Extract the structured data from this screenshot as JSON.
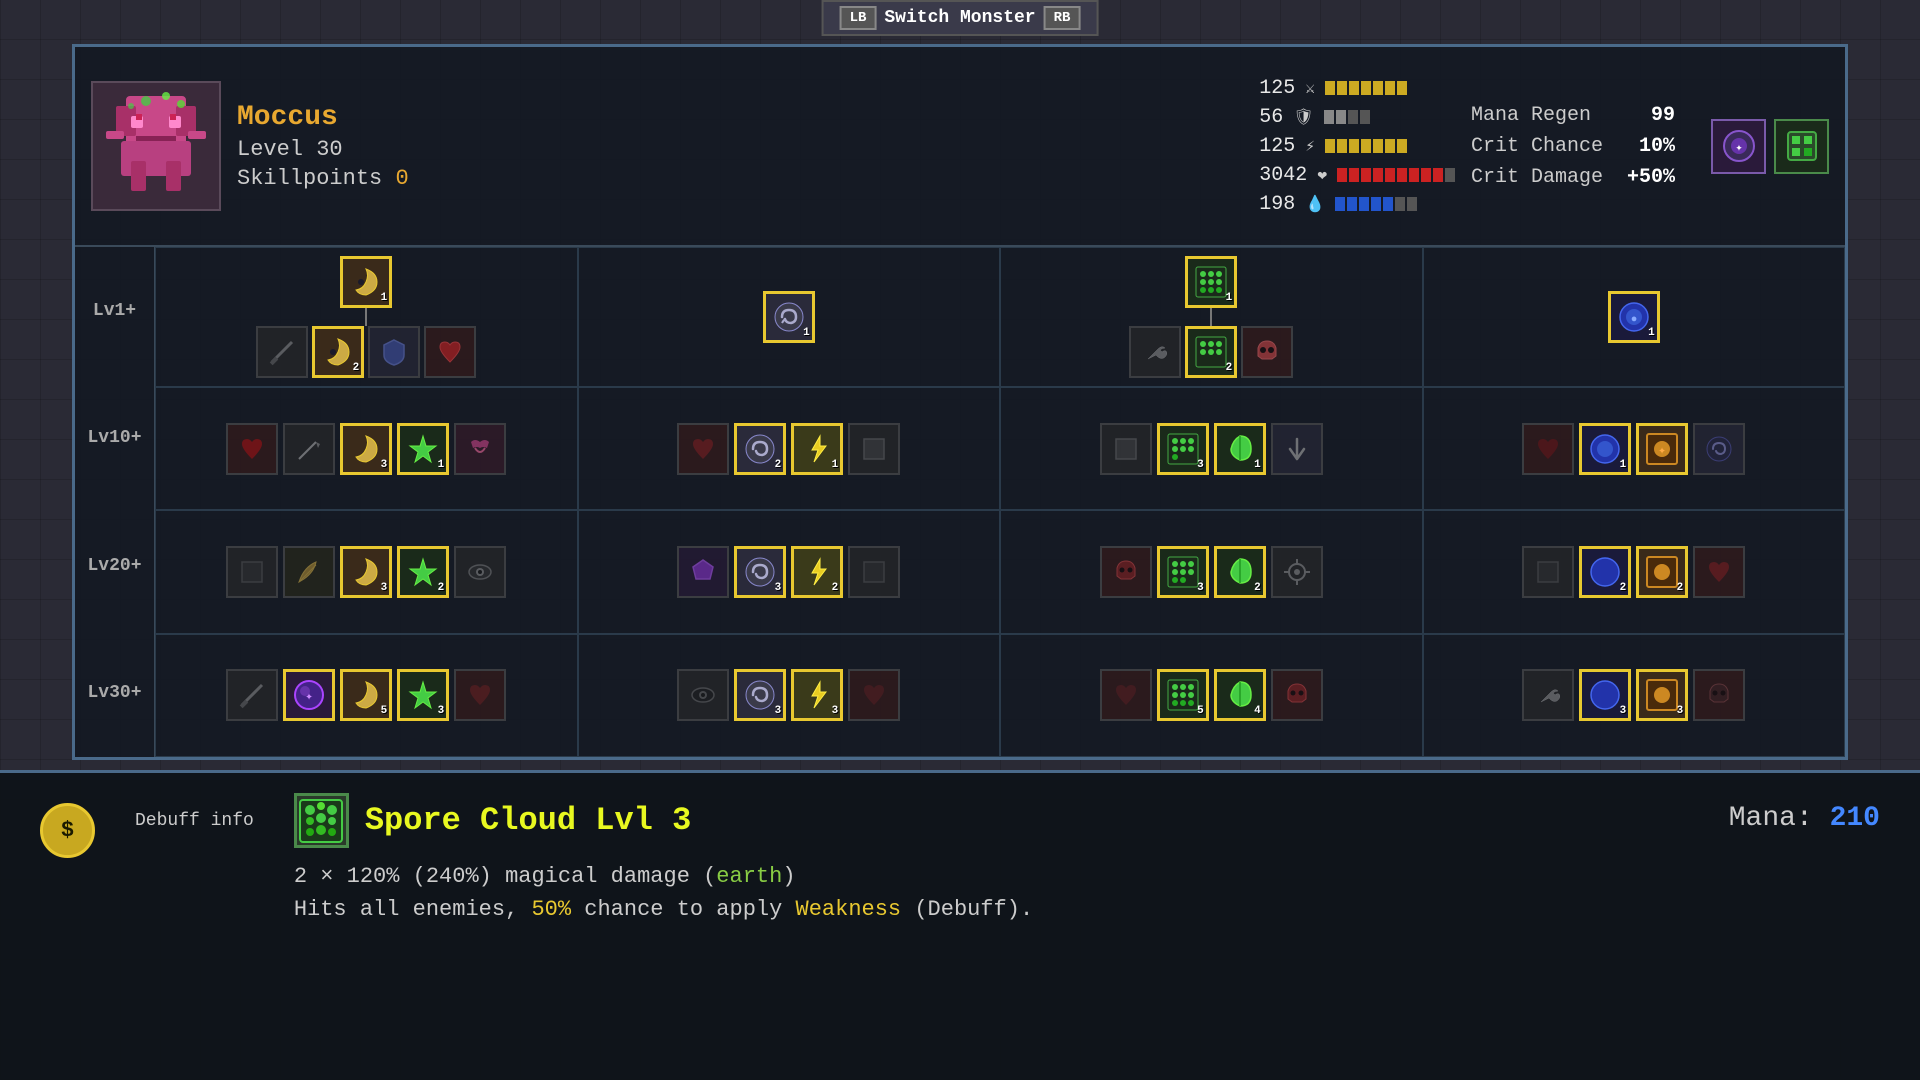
{
  "topBar": {
    "leftTag": "LB",
    "label": "Switch Monster",
    "rightTag": "RB"
  },
  "monster": {
    "name": "Moccus",
    "level": "Level 30",
    "skillpoints_label": "Skillpoints",
    "skillpoints_val": "0",
    "stats": {
      "atk": {
        "val": "125",
        "bars": 7,
        "filled": 7
      },
      "def": {
        "val": "56",
        "bars": 2,
        "filled": 2
      },
      "spd": {
        "val": "125",
        "bars": 7,
        "filled": 7
      },
      "hp": {
        "val": "3042",
        "bars": 9,
        "filled": 9
      },
      "mana": {
        "val": "198",
        "bars": 7,
        "filled": 5
      }
    },
    "rightStats": {
      "mana_regen_label": "Mana Regen",
      "mana_regen_val": "99",
      "crit_chance_label": "Crit Chance",
      "crit_chance_val": "10%",
      "crit_damage_label": "Crit Damage",
      "crit_damage_val": "+50%"
    }
  },
  "levelLabels": [
    "Lv1+",
    "Lv10+",
    "Lv20+",
    "Lv30+"
  ],
  "skillTree": {
    "cols": 4,
    "rows": 4,
    "sections": [
      {
        "row": 0,
        "col": 0,
        "skills": [
          {
            "icon": "🌙",
            "border": "yellow",
            "level": "1",
            "main": true
          },
          {
            "icon": "⚔",
            "border": "gray",
            "level": "",
            "main": false
          },
          {
            "icon": "🌙",
            "border": "yellow",
            "level": "2",
            "main": true
          },
          {
            "icon": "🛡",
            "border": "gray",
            "level": "",
            "main": false
          },
          {
            "icon": "❤",
            "border": "gray",
            "level": "",
            "main": false
          }
        ]
      },
      {
        "row": 0,
        "col": 1,
        "skills": [
          {
            "icon": "🌀",
            "border": "yellow",
            "level": "1",
            "main": true
          }
        ]
      },
      {
        "row": 0,
        "col": 2,
        "skills": [
          {
            "icon": "⬛",
            "border": "yellow",
            "level": "1",
            "main": true
          },
          {
            "icon": "🔧",
            "border": "gray",
            "level": "",
            "main": false
          },
          {
            "icon": "⬛",
            "border": "yellow",
            "level": "2",
            "main": true
          },
          {
            "icon": "💀",
            "border": "gray",
            "level": "",
            "main": false
          }
        ]
      },
      {
        "row": 0,
        "col": 3,
        "skills": [
          {
            "icon": "💧",
            "border": "yellow",
            "level": "1",
            "main": true
          }
        ]
      },
      {
        "row": 1,
        "col": 0,
        "skills": [
          {
            "icon": "❤",
            "border": "gray",
            "level": "",
            "main": false
          },
          {
            "icon": "🔪",
            "border": "gray",
            "level": "",
            "main": false
          },
          {
            "icon": "🌙",
            "border": "yellow",
            "level": "3",
            "main": true
          },
          {
            "icon": "✳",
            "border": "yellow",
            "level": "1",
            "main": true
          },
          {
            "icon": "😈",
            "border": "gray",
            "level": "",
            "main": false
          }
        ]
      },
      {
        "row": 1,
        "col": 1,
        "skills": [
          {
            "icon": "❤",
            "border": "gray",
            "level": "",
            "main": false
          },
          {
            "icon": "🌀",
            "border": "yellow",
            "level": "2",
            "main": true
          },
          {
            "icon": "⚡",
            "border": "yellow",
            "level": "1",
            "main": true
          },
          {
            "icon": "⬛",
            "border": "gray",
            "level": "",
            "main": false
          }
        ]
      },
      {
        "row": 1,
        "col": 2,
        "skills": [
          {
            "icon": "⬛",
            "border": "gray",
            "level": "",
            "main": false
          },
          {
            "icon": "⬛",
            "border": "yellow",
            "level": "3",
            "main": true
          },
          {
            "icon": "🌿",
            "border": "yellow",
            "level": "1",
            "main": true
          },
          {
            "icon": "⬇",
            "border": "gray",
            "level": "",
            "main": false
          }
        ]
      },
      {
        "row": 1,
        "col": 3,
        "skills": [
          {
            "icon": "❤",
            "border": "gray",
            "level": "",
            "main": false
          },
          {
            "icon": "💧",
            "border": "yellow",
            "level": "1",
            "main": true
          },
          {
            "icon": "🟡",
            "border": "yellow",
            "level": "",
            "main": false
          },
          {
            "icon": "🌀",
            "border": "gray",
            "level": "",
            "main": false
          }
        ]
      },
      {
        "row": 2,
        "col": 0,
        "skills": [
          {
            "icon": "⬛",
            "border": "gray",
            "level": "",
            "main": false
          },
          {
            "icon": "🪶",
            "border": "gray",
            "level": "",
            "main": false
          },
          {
            "icon": "🌙",
            "border": "yellow",
            "level": "3",
            "main": true
          },
          {
            "icon": "✳",
            "border": "yellow",
            "level": "2",
            "main": true
          },
          {
            "icon": "👁",
            "border": "gray",
            "level": "",
            "main": false
          }
        ]
      },
      {
        "row": 2,
        "col": 1,
        "skills": [
          {
            "icon": "🟣",
            "border": "gray",
            "level": "",
            "main": false
          },
          {
            "icon": "🌀",
            "border": "yellow",
            "level": "3",
            "main": true
          },
          {
            "icon": "⚡",
            "border": "yellow",
            "level": "2",
            "main": true
          },
          {
            "icon": "⬛",
            "border": "gray",
            "level": "",
            "main": false
          }
        ]
      },
      {
        "row": 2,
        "col": 2,
        "skills": [
          {
            "icon": "💀",
            "border": "gray",
            "level": "",
            "main": false
          },
          {
            "icon": "⬛",
            "border": "yellow",
            "level": "3",
            "main": true
          },
          {
            "icon": "🌿",
            "border": "yellow",
            "level": "2",
            "main": true
          },
          {
            "icon": "⚙",
            "border": "gray",
            "level": "",
            "main": false
          }
        ]
      },
      {
        "row": 2,
        "col": 3,
        "skills": [
          {
            "icon": "⬛",
            "border": "gray",
            "level": "",
            "main": false
          },
          {
            "icon": "💧",
            "border": "yellow",
            "level": "2",
            "main": true
          },
          {
            "icon": "🟡",
            "border": "yellow",
            "level": "2",
            "main": true
          },
          {
            "icon": "❤",
            "border": "gray",
            "level": "",
            "main": false
          }
        ]
      },
      {
        "row": 3,
        "col": 0,
        "skills": [
          {
            "icon": "⚔",
            "border": "gray",
            "level": "",
            "main": false
          },
          {
            "icon": "🔮",
            "border": "yellow",
            "level": "",
            "main": true
          },
          {
            "icon": "🌙",
            "border": "yellow",
            "level": "5",
            "main": true
          },
          {
            "icon": "✳",
            "border": "yellow",
            "level": "3",
            "main": true
          },
          {
            "icon": "❤",
            "border": "gray",
            "level": "",
            "main": false
          }
        ]
      },
      {
        "row": 3,
        "col": 1,
        "skills": [
          {
            "icon": "👁",
            "border": "gray",
            "level": "",
            "main": false
          },
          {
            "icon": "🌀",
            "border": "yellow",
            "level": "3",
            "main": true
          },
          {
            "icon": "⚡",
            "border": "yellow",
            "level": "3",
            "main": true
          },
          {
            "icon": "❤",
            "border": "gray",
            "level": "",
            "main": false
          }
        ]
      },
      {
        "row": 3,
        "col": 2,
        "skills": [
          {
            "icon": "❤",
            "border": "gray",
            "level": "",
            "main": false
          },
          {
            "icon": "⬛",
            "border": "yellow",
            "level": "5",
            "main": true
          },
          {
            "icon": "🌿",
            "border": "yellow",
            "level": "4",
            "main": true
          },
          {
            "icon": "💀",
            "border": "gray",
            "level": "",
            "main": false
          }
        ]
      },
      {
        "row": 3,
        "col": 3,
        "skills": [
          {
            "icon": "🔧",
            "border": "gray",
            "level": "",
            "main": false
          },
          {
            "icon": "💧",
            "border": "yellow",
            "level": "3",
            "main": true
          },
          {
            "icon": "🟡",
            "border": "yellow",
            "level": "3",
            "main": true
          },
          {
            "icon": "💀",
            "border": "gray",
            "level": "",
            "main": false
          }
        ]
      }
    ]
  },
  "bottomPanel": {
    "debuff_label": "Debuff info",
    "skill_name": "Spore Cloud Lvl 3",
    "skill_icon": "✳",
    "skill_desc_line1": "2 × 120% (240%) magical damage (earth)",
    "skill_desc_line2": "Hits all enemies, 50% chance to apply Weakness (Debuff).",
    "mana_label": "Mana:",
    "mana_val": "210"
  }
}
